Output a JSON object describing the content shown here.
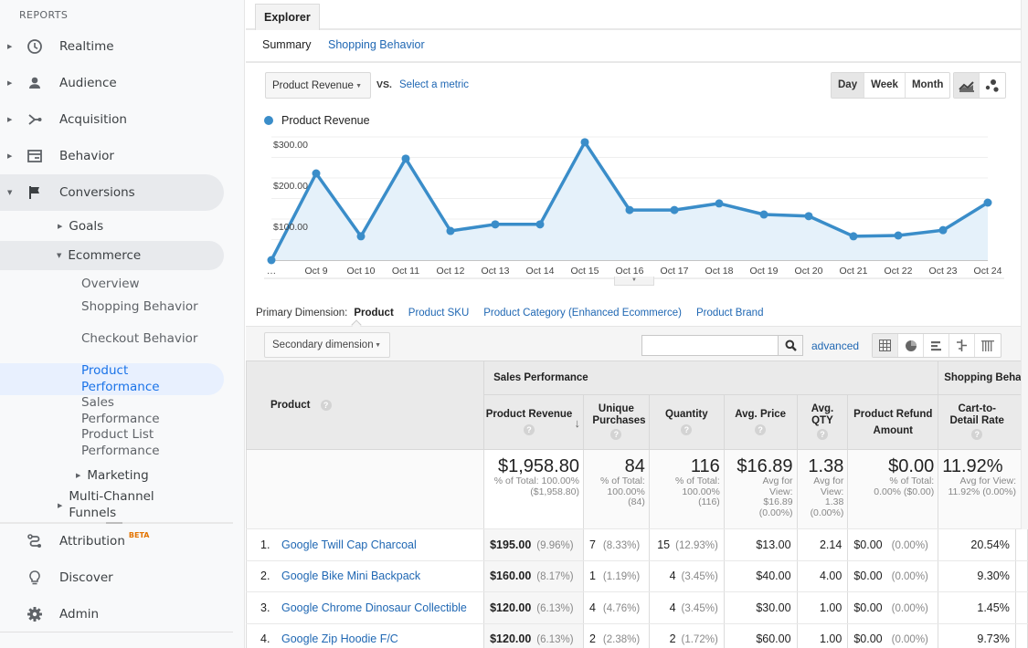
{
  "sidebar": {
    "section_label": "REPORTS",
    "items": [
      {
        "label": "Realtime",
        "icon": "clock-icon"
      },
      {
        "label": "Audience",
        "icon": "person-icon"
      },
      {
        "label": "Acquisition",
        "icon": "acquisition-icon"
      },
      {
        "label": "Behavior",
        "icon": "behavior-icon"
      },
      {
        "label": "Conversions",
        "icon": "flag-icon"
      }
    ],
    "conversions_children": {
      "goals": "Goals",
      "ecommerce": "Ecommerce",
      "ecommerce_children": [
        "Overview",
        "Shopping Behavior",
        "Checkout Behavior",
        "Product Performance",
        "Sales Performance",
        "Product List Performance"
      ],
      "active_child": "Product Performance",
      "marketing": "Marketing",
      "multi_channel": "Multi-Channel Funnels"
    },
    "bottom_items": [
      {
        "label": "Attribution",
        "icon": "attribution-icon",
        "badge": "BETA"
      },
      {
        "label": "Discover",
        "icon": "lightbulb-icon"
      },
      {
        "label": "Admin",
        "icon": "gear-icon"
      }
    ]
  },
  "explorer": {
    "tab_label": "Explorer",
    "subtabs": {
      "selected": "Summary",
      "other": "Shopping Behavior"
    },
    "metric_select": "Product Revenue",
    "vs_label": "VS.",
    "select_metric": "Select a metric",
    "period_buttons": [
      "Day",
      "Week",
      "Month"
    ],
    "period_selected": "Day",
    "chart_type_buttons": [
      "line-chart-icon",
      "motion-chart-icon"
    ]
  },
  "chart_data": {
    "type": "area",
    "series": [
      {
        "name": "Product Revenue",
        "color": "#3a8dc9",
        "values": [
          0,
          211,
          58,
          247,
          71,
          87,
          87,
          287,
          122,
          122,
          138,
          111,
          107,
          58,
          60,
          73,
          140
        ]
      }
    ],
    "x": [
      "…",
      "Oct 9",
      "Oct 10",
      "Oct 11",
      "Oct 12",
      "Oct 13",
      "Oct 14",
      "Oct 15",
      "Oct 16",
      "Oct 17",
      "Oct 18",
      "Oct 19",
      "Oct 20",
      "Oct 21",
      "Oct 22",
      "Oct 23",
      "Oct 24"
    ],
    "y_ticks": [
      "$100.00",
      "$200.00",
      "$300.00"
    ],
    "y_tick_values": [
      100,
      200,
      300
    ],
    "ylim": [
      0,
      300
    ],
    "grid": true,
    "legend": "top-left",
    "title": "",
    "xlabel": "",
    "ylabel": ""
  },
  "dimensions": {
    "label": "Primary Dimension:",
    "current": "Product",
    "options": [
      "Product SKU",
      "Product Category (Enhanced Ecommerce)",
      "Product Brand"
    ],
    "secondary": "Secondary dimension",
    "search_value": "",
    "advanced": "advanced"
  },
  "table": {
    "product_header": "Product",
    "groups": {
      "sales": "Sales Performance",
      "shopping": "Shopping Behav"
    },
    "columns": [
      "Product Revenue",
      "Unique Purchases",
      "Quantity",
      "Avg. Price",
      "Avg. QTY",
      "Product Refund Amount",
      "Cart-to-Detail Rate"
    ],
    "totals": {
      "revenue": {
        "value": "$1,958.80",
        "sub": "% of Total: 100.00% ($1,958.80)"
      },
      "unique": {
        "value": "84",
        "sub": "% of Total: 100.00% (84)"
      },
      "quantity": {
        "value": "116",
        "sub": "% of Total: 100.00% (116)"
      },
      "avg_price": {
        "value": "$16.89",
        "sub": "Avg for View: $16.89 (0.00%)"
      },
      "avg_qty": {
        "value": "1.38",
        "sub": "Avg for View: 1.38 (0.00%)"
      },
      "refund": {
        "value": "$0.00",
        "sub": "% of Total: 0.00% ($0.00)"
      },
      "cart_detail": {
        "value": "11.92%",
        "sub": "Avg for View: 11.92% (0.00%)"
      }
    },
    "rows": [
      {
        "idx": "1.",
        "product": "Google Twill Cap Charcoal",
        "revenue": "$195.00",
        "revenue_pct": "(9.96%)",
        "unique": "7",
        "unique_pct": "(8.33%)",
        "qty": "15",
        "qty_pct": "(12.93%)",
        "avg_price": "$13.00",
        "avg_qty": "2.14",
        "refund": "$0.00",
        "refund_pct": "(0.00%)",
        "cart_detail": "20.54%"
      },
      {
        "idx": "2.",
        "product": "Google Bike Mini Backpack",
        "revenue": "$160.00",
        "revenue_pct": "(8.17%)",
        "unique": "1",
        "unique_pct": "(1.19%)",
        "qty": "4",
        "qty_pct": "(3.45%)",
        "avg_price": "$40.00",
        "avg_qty": "4.00",
        "refund": "$0.00",
        "refund_pct": "(0.00%)",
        "cart_detail": "9.30%"
      },
      {
        "idx": "3.",
        "product": "Google Chrome Dinosaur Collectible",
        "revenue": "$120.00",
        "revenue_pct": "(6.13%)",
        "unique": "4",
        "unique_pct": "(4.76%)",
        "qty": "4",
        "qty_pct": "(3.45%)",
        "avg_price": "$30.00",
        "avg_qty": "1.00",
        "refund": "$0.00",
        "refund_pct": "(0.00%)",
        "cart_detail": "1.45%"
      },
      {
        "idx": "4.",
        "product": "Google Zip Hoodie F/C",
        "revenue": "$120.00",
        "revenue_pct": "(6.13%)",
        "unique": "2",
        "unique_pct": "(2.38%)",
        "qty": "2",
        "qty_pct": "(1.72%)",
        "avg_price": "$60.00",
        "avg_qty": "1.00",
        "refund": "$0.00",
        "refund_pct": "(0.00%)",
        "cart_detail": "9.73%"
      }
    ]
  }
}
